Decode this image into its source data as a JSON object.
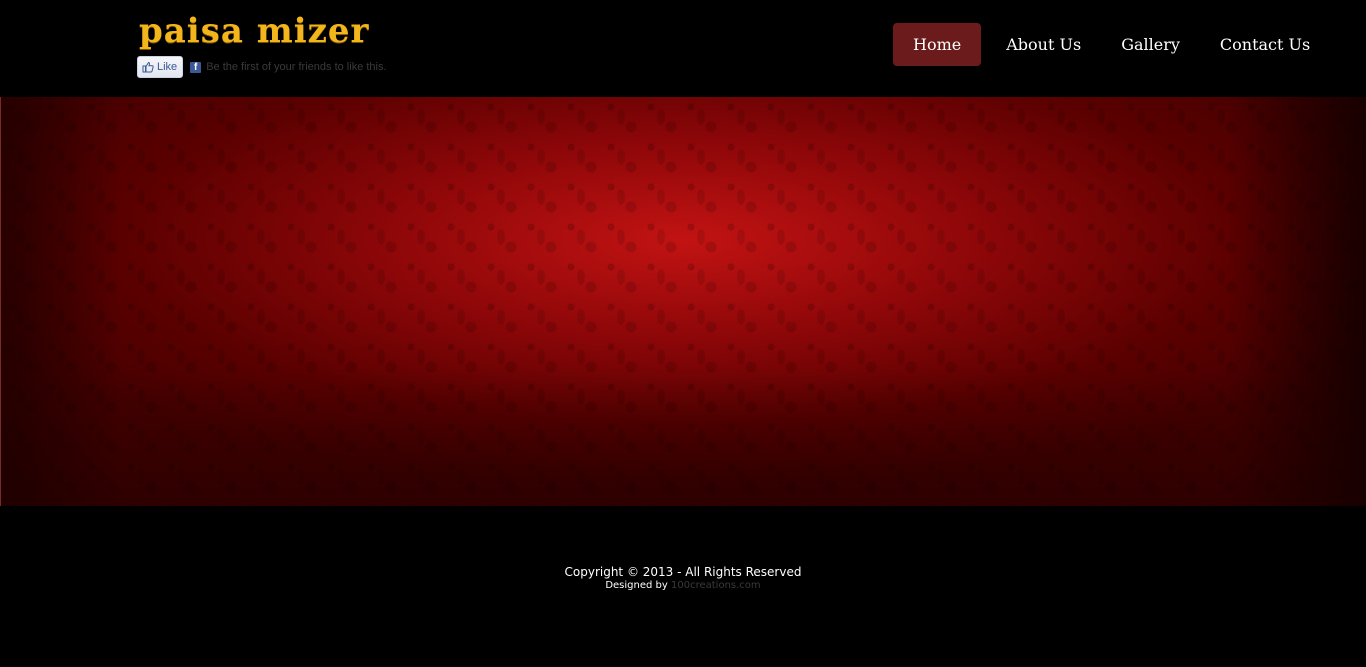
{
  "header": {
    "logo_text": "paisa mizer",
    "facebook": {
      "like_label": "Like",
      "fb_letter": "f",
      "social_text": "Be the first of your friends to like this."
    }
  },
  "nav": {
    "items": [
      {
        "label": "Home",
        "active": true
      },
      {
        "label": "About Us",
        "active": false
      },
      {
        "label": "Gallery",
        "active": false
      },
      {
        "label": "Contact Us",
        "active": false
      }
    ]
  },
  "footer": {
    "copyright": "Copyright © 2013 - All Rights Reserved",
    "designed_by_label": "Designed by",
    "designer_link": "100creations.com"
  },
  "colors": {
    "logo": "#f2b51c",
    "nav_active_bg": "#6b1b1b",
    "banner_red": "#b80c10",
    "page_bg": "#000000"
  }
}
